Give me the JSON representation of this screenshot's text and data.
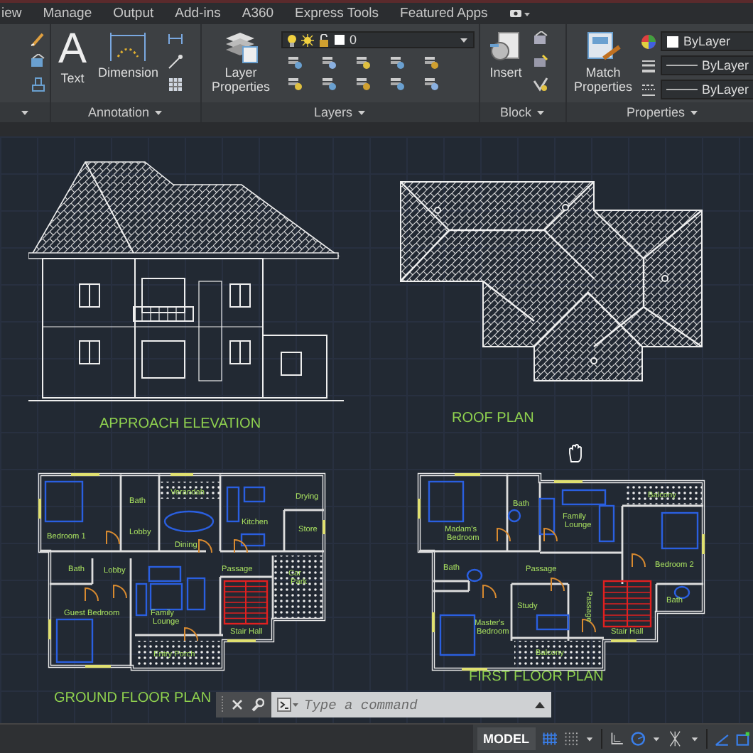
{
  "menu_tabs": [
    "iew",
    "Manage",
    "Output",
    "Add-ins",
    "A360",
    "Express Tools",
    "Featured Apps"
  ],
  "ribbon_panels": [
    {
      "kind": "annotation",
      "title": "Annotation",
      "buttons": [
        {
          "label": "Text",
          "glyph": "A"
        },
        {
          "label": "Dimension"
        }
      ]
    },
    {
      "kind": "layers",
      "title": "Layers",
      "buttons": [
        {
          "label": "Layer Properties"
        }
      ],
      "layer": "0"
    },
    {
      "kind": "block",
      "title": "Block",
      "buttons": [
        {
          "label": "Insert"
        }
      ]
    },
    {
      "kind": "properties",
      "title": "Properties",
      "buttons": [
        {
          "label": "Match Properties"
        }
      ],
      "values": [
        "ByLayer",
        "ByLayer",
        "ByLayer"
      ]
    }
  ],
  "drawings": [
    {
      "kind": "elevation",
      "caption": "APPROACH ELEVATION"
    },
    {
      "kind": "roof_plan",
      "caption": "ROOF PLAN"
    },
    {
      "kind": "floor_plan",
      "caption": "GROUND FLOOR PLAN",
      "rooms": [
        "Bedroom 1",
        "Bath",
        "Lobby",
        "Verandah",
        "Dining",
        "Kitchen",
        "Drying",
        "Store",
        "Bath",
        "Lobby",
        "Passage",
        "Car Park",
        "Guest Bedroom",
        "Family Lounge",
        "Stair Hall",
        "Entry Porch"
      ]
    },
    {
      "kind": "floor_plan",
      "caption": "FIRST FLOOR PLAN",
      "rooms": [
        "Madam's Bedroom",
        "Bath",
        "Family Lounge",
        "Balcony",
        "Bath",
        "Passage",
        "Bedroom 2",
        "Study",
        "Passage",
        "Stair Hall",
        "Bath",
        "Master's Bedroom",
        "Balcony"
      ]
    }
  ],
  "command_line": {
    "placeholder": "Type a command"
  },
  "status_bar": {
    "space": "MODEL"
  }
}
